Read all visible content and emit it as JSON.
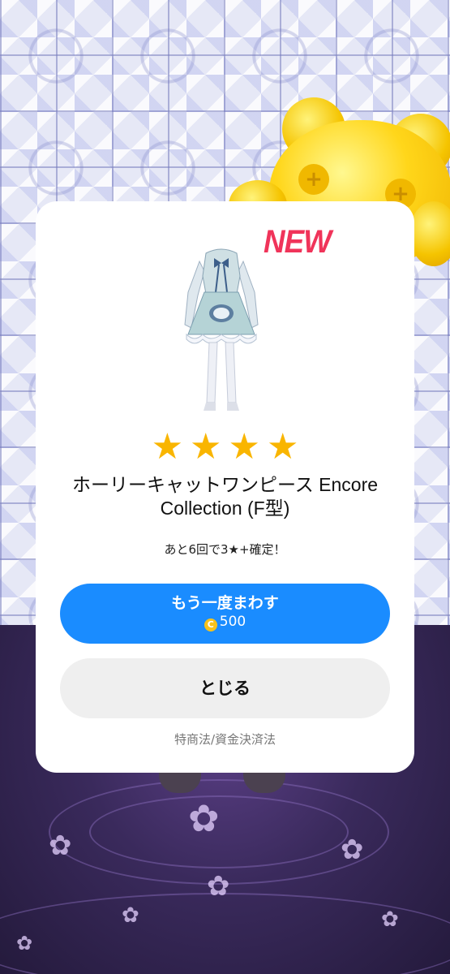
{
  "badge": {
    "new_label": "NEW"
  },
  "item": {
    "rarity_stars": 4,
    "name": "ホーリーキャットワンピース Encore Collection (F型)"
  },
  "pity_text": "あと6回で3★+確定！",
  "buttons": {
    "spin_again_label": "もう一度まわす",
    "spin_cost": "500",
    "close_label": "とじる"
  },
  "legal_link": "特商法/資金決済法",
  "colors": {
    "primary_button": "#1a8cff",
    "star": "#f9b500",
    "new_badge": "#f0345a",
    "coin": "#f6c21b"
  },
  "icons": {
    "star": "star-icon",
    "coin": "coin-icon"
  }
}
